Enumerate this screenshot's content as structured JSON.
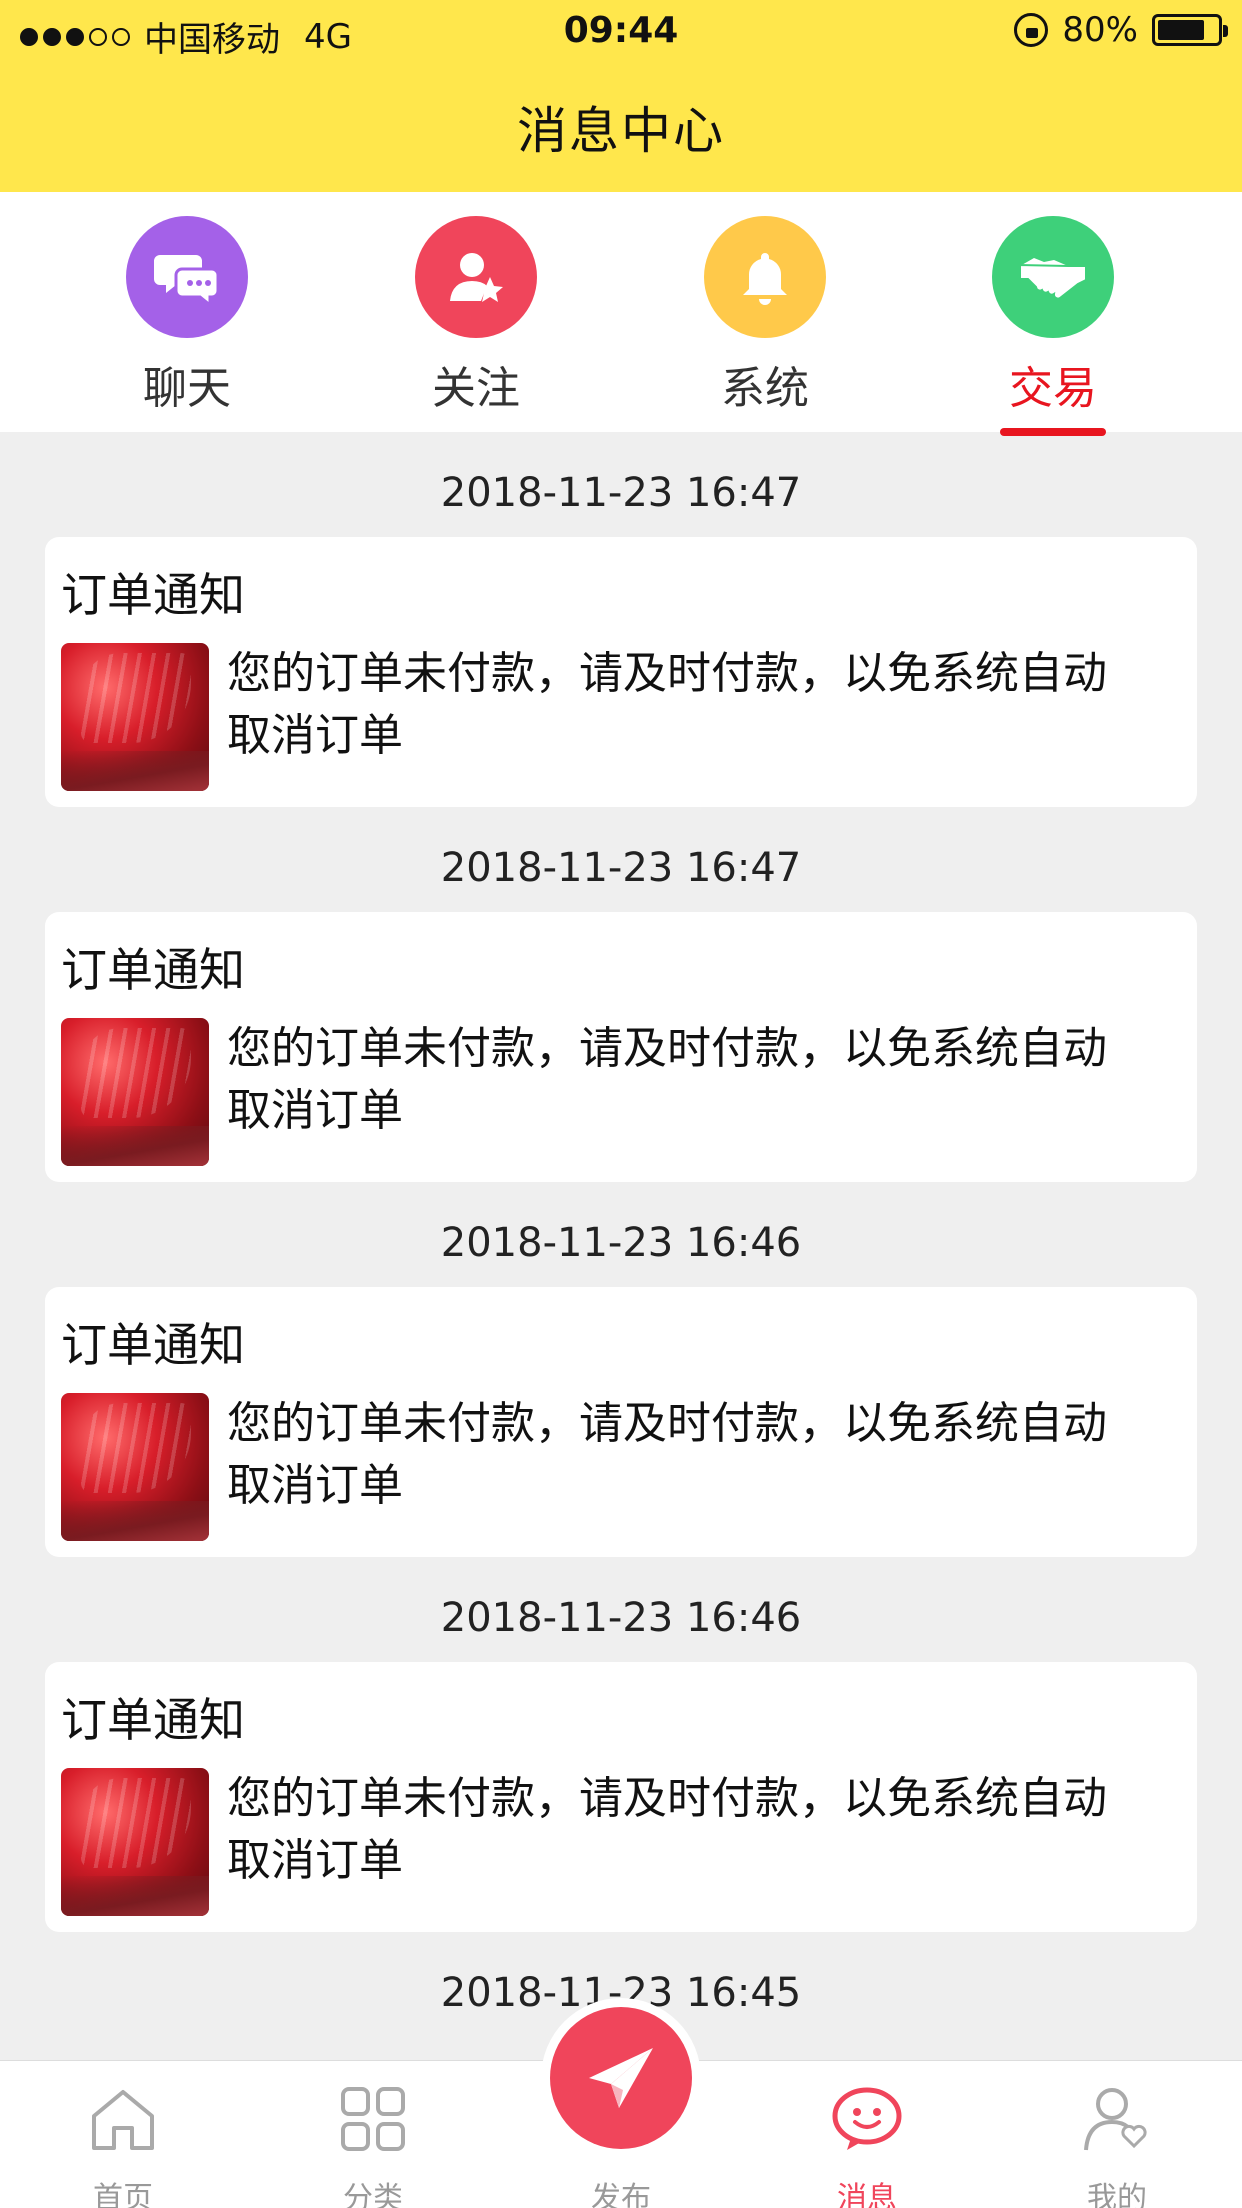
{
  "status_bar": {
    "carrier": "中国移动",
    "network": "4G",
    "time": "09:44",
    "battery": "80%"
  },
  "header": {
    "title": "消息中心"
  },
  "tabs": [
    {
      "label": "聊天",
      "icon": "chat-bubbles-icon",
      "color": "#a461e8"
    },
    {
      "label": "关注",
      "icon": "user-star-icon",
      "color": "#f0455b"
    },
    {
      "label": "系统",
      "icon": "bell-icon",
      "color": "#ffc94a"
    },
    {
      "label": "交易",
      "icon": "handshake-icon",
      "color": "#3ed07a",
      "active": true
    }
  ],
  "messages": [
    {
      "time": "2018-11-23 16:47",
      "title": "订单通知",
      "text": "您的订单未付款，请及时付款，以免系统自动取消订单"
    },
    {
      "time": "2018-11-23 16:47",
      "title": "订单通知",
      "text": "您的订单未付款，请及时付款，以免系统自动取消订单"
    },
    {
      "time": "2018-11-23 16:46",
      "title": "订单通知",
      "text": "您的订单未付款，请及时付款，以免系统自动取消订单"
    },
    {
      "time": "2018-11-23 16:46",
      "title": "订单通知",
      "text": "您的订单未付款，请及时付款，以免系统自动取消订单"
    },
    {
      "time": "2018-11-23 16:45",
      "title": "",
      "text": ""
    }
  ],
  "tabbar": {
    "home": "首页",
    "category": "分类",
    "publish": "发布",
    "message": "消息",
    "mine": "我的"
  },
  "colors": {
    "header_bg": "#ffe74c",
    "accent_red": "#e8151f",
    "tabbar_active": "#f0455b"
  }
}
